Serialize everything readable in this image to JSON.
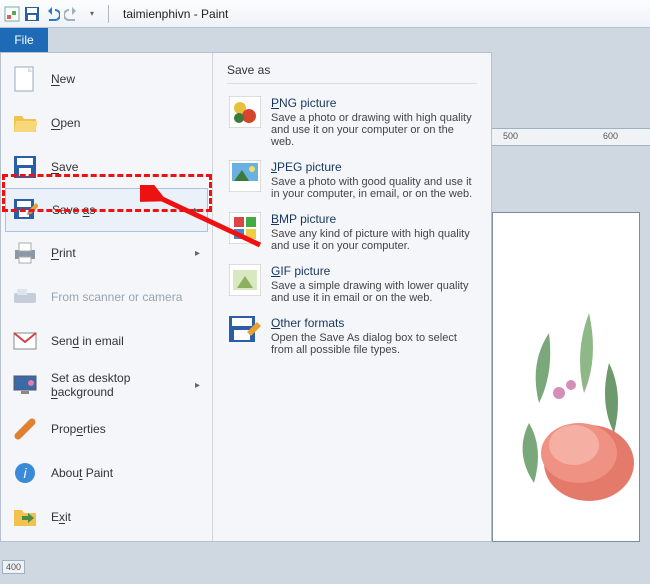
{
  "title": "taimienphivn - Paint",
  "file_tab": "File",
  "ruler_marks": {
    "m500": "500",
    "m600": "600"
  },
  "ruler_v": "400",
  "menu": {
    "new": "New",
    "open": "Open",
    "save": "Save",
    "save_as": "Save as",
    "print": "Print",
    "scanner": "From scanner or camera",
    "email": "Send in email",
    "desktop": "Set as desktop background",
    "properties": "Properties",
    "about": "About Paint",
    "exit": "Exit"
  },
  "sub": {
    "title": "Save as",
    "png": {
      "h": "PNG picture",
      "d": "Save a photo or drawing with high quality and use it on your computer or on the web."
    },
    "jpeg": {
      "h": "JPEG picture",
      "d": "Save a photo with good quality and use it in your computer, in email, or on the web."
    },
    "bmp": {
      "h": "BMP picture",
      "d": "Save any kind of picture with high quality and use it on your computer."
    },
    "gif": {
      "h": "GIF picture",
      "d": "Save a simple drawing with lower quality and use it in email or on the web."
    },
    "other": {
      "h": "Other formats",
      "d": "Open the Save As dialog box to select from all possible file types."
    }
  }
}
